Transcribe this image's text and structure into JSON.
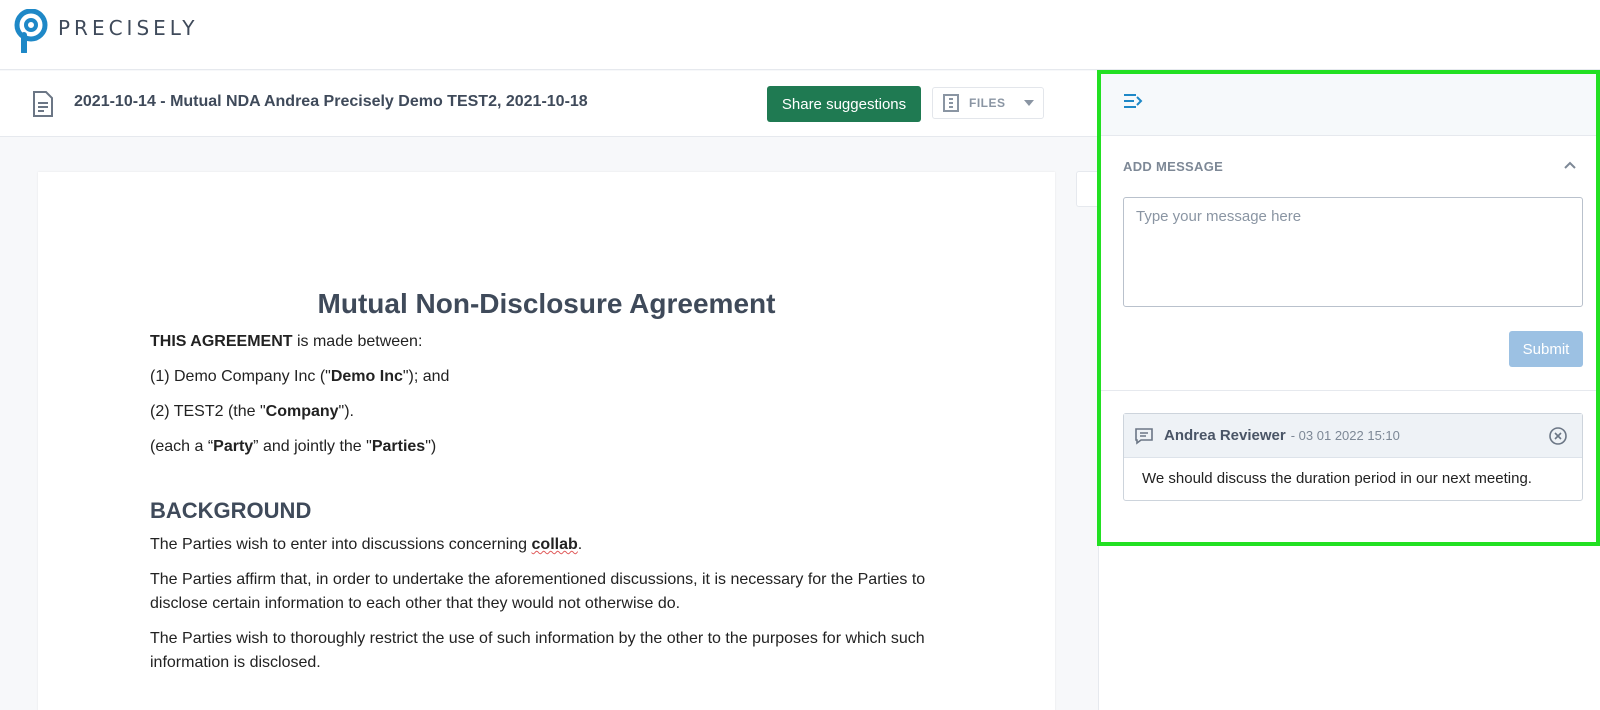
{
  "app": {
    "brand": "PRECISELY",
    "brand_color": "#1e88c7"
  },
  "document_header": {
    "title": "2021-10-14 - Mutual NDA Andrea Precisely Demo TEST2, 2021-10-18",
    "share_button": "Share suggestions",
    "files_button": "FILES",
    "accent": "#1f7a52"
  },
  "document": {
    "heading": "Mutual Non-Disclosure Agreement",
    "intro": {
      "bold": "THIS AGREEMENT",
      "rest": " is made between:"
    },
    "party1": {
      "pre": "(1) Demo Company Inc (\"",
      "bold": "Demo Inc",
      "post": "\"); and"
    },
    "party2": {
      "pre": "(2) TEST2 (the \"",
      "bold": "Company",
      "post": "\")."
    },
    "each_party": {
      "pre": "(each a “",
      "bold1": "Party",
      "mid": "” and jointly the \"",
      "bold2": "Parties",
      "post": "\")"
    },
    "background_heading": "BACKGROUND",
    "bg1": {
      "pre": "The Parties wish to enter into discussions concerning ",
      "bold": "collab",
      "post": "."
    },
    "bg2": "The Parties affirm that, in order to undertake the aforementioned discussions, it is necessary for the Parties to disclose certain information to each other that they would not otherwise do.",
    "bg3": "The Parties wish to thoroughly restrict the use of such information by the other to the purposes for which such information is disclosed."
  },
  "panel": {
    "add_message_title": "ADD MESSAGE",
    "input_placeholder": "Type your message here",
    "submit_label": "Submit",
    "comments": [
      {
        "author": "Andrea Reviewer",
        "date": "- 03 01 2022 15:10",
        "text": "We should discuss the duration period in our next meeting."
      }
    ]
  }
}
